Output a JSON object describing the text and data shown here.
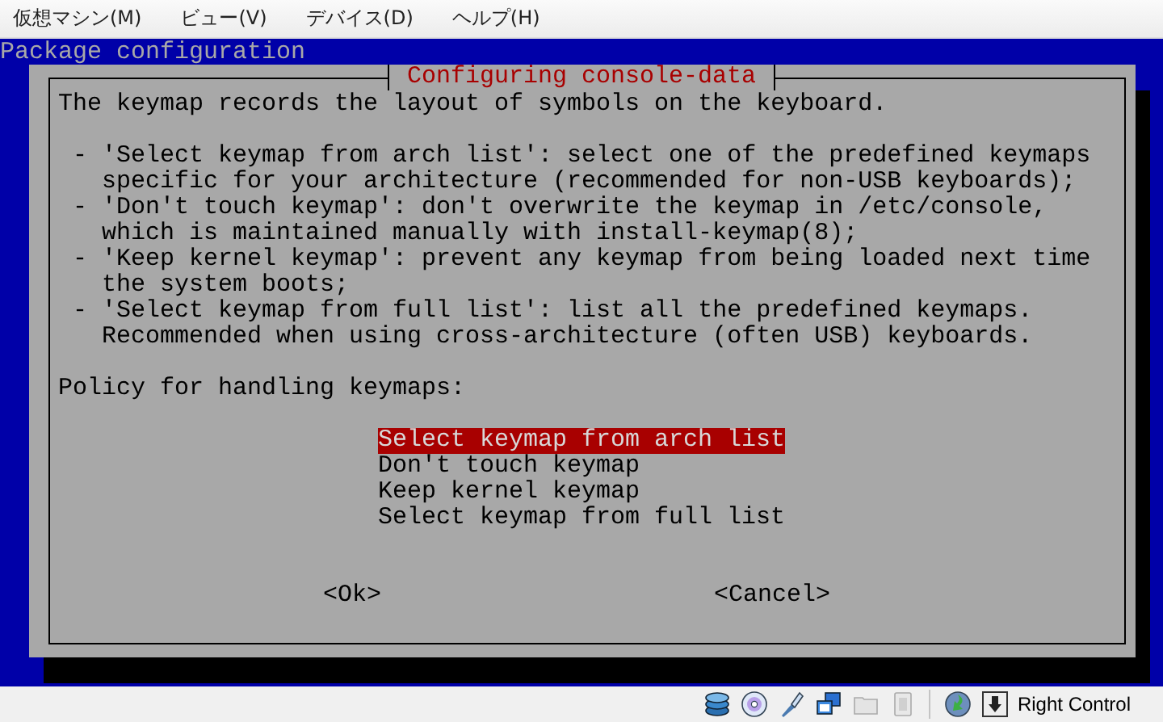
{
  "menu_bar": [
    "仮想マシン(M)",
    "ビュー(V)",
    "デバイス(D)",
    "ヘルプ(H)"
  ],
  "console": {
    "title": "Package configuration",
    "dialog": {
      "title": "Configuring console-data",
      "intro": "The keymap records the layout of symbols on the keyboard.",
      "notes": [
        {
          "lines": [
            "- 'Select keymap from arch list': select one of the predefined keymaps",
            "specific for your architecture (recommended for non-USB keyboards);"
          ]
        },
        {
          "lines": [
            "- 'Don't touch keymap': don't overwrite the keymap in /etc/console,",
            "which is maintained manually with install-keymap(8);"
          ]
        },
        {
          "lines": [
            "- 'Keep kernel keymap': prevent any keymap from being loaded next time",
            "the system boots;"
          ]
        },
        {
          "lines": [
            "- 'Select keymap from full list': list all the predefined keymaps.",
            "Recommended when using cross-architecture (often USB) keyboards."
          ]
        }
      ],
      "prompt": "Policy for handling keymaps:",
      "options": [
        {
          "label": "Select keymap from arch list",
          "selected": true
        },
        {
          "label": "Don't touch keymap",
          "selected": false
        },
        {
          "label": "Keep kernel keymap",
          "selected": false
        },
        {
          "label": "Select keymap from full list",
          "selected": false
        }
      ],
      "buttons": [
        "<Ok>",
        "<Cancel>"
      ]
    }
  },
  "status_bar": {
    "host_key": "Right Control"
  }
}
